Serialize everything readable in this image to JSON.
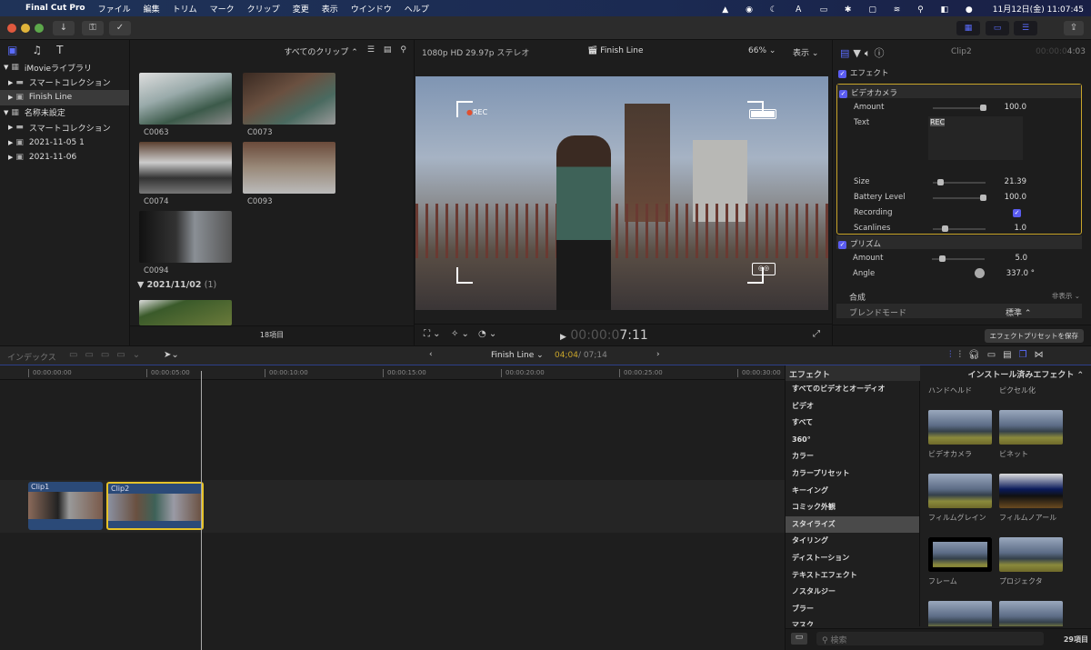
{
  "menubar": {
    "app": "Final Cut Pro",
    "items": [
      "ファイル",
      "編集",
      "トリム",
      "マーク",
      "クリップ",
      "変更",
      "表示",
      "ウインドウ",
      "ヘルプ"
    ],
    "clock": "11月12日(金) 11:07:45"
  },
  "sidebar": {
    "items": [
      {
        "label": "iMovieライブラリ",
        "level": 0,
        "icon": "library-icon",
        "arrow": "▼"
      },
      {
        "label": "スマートコレクション",
        "level": 1,
        "icon": "folder-icon",
        "arrow": "▶"
      },
      {
        "label": "Finish Line",
        "level": 1,
        "icon": "event-icon",
        "arrow": "▶",
        "selected": true
      },
      {
        "label": "名称未設定",
        "level": 0,
        "icon": "library-icon",
        "arrow": "▼"
      },
      {
        "label": "スマートコレクション",
        "level": 1,
        "icon": "folder-icon",
        "arrow": "▶"
      },
      {
        "label": "2021-11-05 1",
        "level": 1,
        "icon": "event-icon",
        "arrow": "▶"
      },
      {
        "label": "2021-11-06",
        "level": 1,
        "icon": "event-icon",
        "arrow": "▶"
      }
    ]
  },
  "browser": {
    "filter": "すべてのクリップ ⌃",
    "clips": [
      "C0063",
      "C0073",
      "C0074",
      "C0093",
      "C0094"
    ],
    "group_date": "2021/11/02",
    "group_count": "(1)",
    "item_count": "18項目"
  },
  "viewer": {
    "format": "1080p HD 29.97p ステレオ",
    "project": "Finish Line",
    "zoom": "66% ⌄",
    "view": "表示 ⌄",
    "overlay_rec": "REC",
    "timecode_dim": "00:00:0",
    "timecode": "7:11"
  },
  "inspector": {
    "clip": "Clip2",
    "timecode_dim": "00:00:0",
    "timecode": "4:03",
    "effects_header": "エフェクト",
    "videocam": {
      "name": "ビデオカメラ",
      "amount_label": "Amount",
      "amount": "100.0",
      "amount_pct": 100,
      "text_label": "Text",
      "text_value": "REC",
      "size_label": "Size",
      "size": "21.39",
      "size_pct": 10,
      "battery_label": "Battery Level",
      "battery": "100.0",
      "battery_pct": 100,
      "recording_label": "Recording",
      "recording": true,
      "scanlines_label": "Scanlines",
      "scanlines": "1.0",
      "scanlines_pct": 20
    },
    "prism": {
      "name": "プリズム",
      "amount_label": "Amount",
      "amount": "5.0",
      "amount_pct": 15,
      "angle_label": "Angle",
      "angle": "337.0 °"
    },
    "composite": {
      "label": "合成",
      "toggle": "非表示 ⌄",
      "blend_label": "ブレンドモード",
      "blend_value": "標準 ⌃"
    },
    "save_preset": "エフェクトプリセットを保存"
  },
  "timeline": {
    "index": "インデックス",
    "project": "Finish Line ⌄",
    "position": "04;04",
    "duration": "/ 07;14",
    "ticks": [
      "00:00:00:00",
      "00:00:05:00",
      "00:00:10:00",
      "00:00:15:00",
      "00:00:20:00",
      "00:00:25:00",
      "00:00:30:00"
    ],
    "clips": [
      "Clip1",
      "Clip2"
    ]
  },
  "effects": {
    "header": "エフェクト",
    "source": "インストール済みエフェクト ⌃",
    "categories": [
      "すべてのビデオとオーディオ",
      "ビデオ",
      "すべて",
      "360°",
      "カラー",
      "カラープリセット",
      "キーイング",
      "コミック外観",
      "スタイライズ",
      "タイリング",
      "ディストーション",
      "テキストエフェクト",
      "ノスタルジー",
      "ブラー",
      "マスク"
    ],
    "selected_category": "スタイライズ",
    "items": [
      "ハンドヘルド",
      "ピクセル化",
      "ビデオカメラ",
      "ビネット",
      "フィルムグレイン",
      "フィルムノアール",
      "フレーム",
      "プロジェクタ"
    ],
    "search_placeholder": "検索",
    "count": "29項目"
  },
  "colors": {
    "accent": "#5a5cf0",
    "selection": "#e6c229",
    "clip": "#2b4a78"
  }
}
